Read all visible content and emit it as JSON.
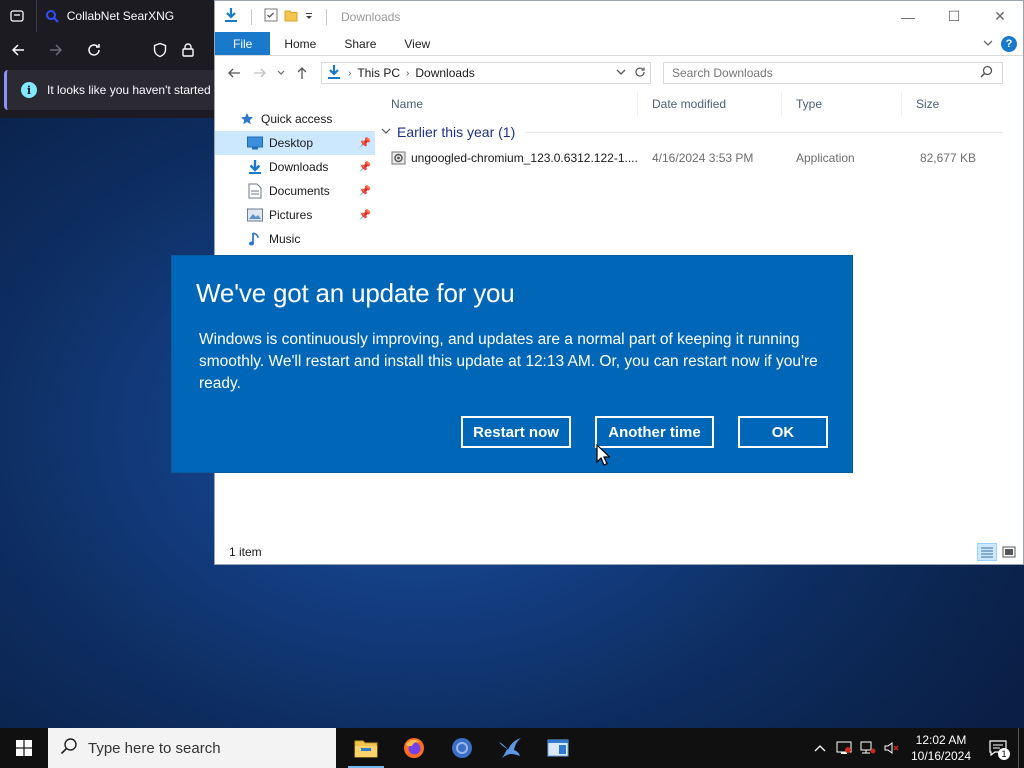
{
  "browser": {
    "tab_title": "CollabNet SearXNG",
    "infobar_text": "It looks like you haven't started"
  },
  "explorer": {
    "window_title": "Downloads",
    "ribbon_tabs": [
      "File",
      "Home",
      "Share",
      "View"
    ],
    "breadcrumb": [
      "This PC",
      "Downloads"
    ],
    "search_placeholder": "Search Downloads",
    "nav_items": [
      {
        "label": "Quick access",
        "icon": "star-icon"
      },
      {
        "label": "Desktop",
        "icon": "desktop-folder-icon",
        "pinned": true,
        "selected": true
      },
      {
        "label": "Downloads",
        "icon": "download-folder-icon",
        "pinned": true
      },
      {
        "label": "Documents",
        "icon": "documents-folder-icon",
        "pinned": true
      },
      {
        "label": "Pictures",
        "icon": "pictures-folder-icon",
        "pinned": true
      },
      {
        "label": "Music",
        "icon": "music-folder-icon"
      }
    ],
    "columns": [
      "Name",
      "Date modified",
      "Type",
      "Size"
    ],
    "group_label": "Earlier this year (1)",
    "files": [
      {
        "name": "ungoogled-chromium_123.0.6312.122-1....",
        "date": "4/16/2024 3:53 PM",
        "type": "Application",
        "size": "82,677 KB"
      }
    ],
    "status": "1 item"
  },
  "dialog": {
    "title": "We've got an update for you",
    "body": "Windows is continuously improving, and updates are a normal part of keeping it running smoothly. We'll restart and install this update at 12:13 AM. Or, you can restart now if you're ready.",
    "buttons": {
      "restart": "Restart now",
      "later": "Another time",
      "ok": "OK"
    }
  },
  "taskbar": {
    "search_placeholder": "Type here to search",
    "pinned_apps": [
      "file-explorer-icon",
      "firefox-icon",
      "chromium-icon",
      "bird-app-icon",
      "window-app-icon"
    ],
    "clock_time": "12:02 AM",
    "clock_date": "10/16/2024",
    "notification_count": "1"
  },
  "colors": {
    "dialog_blue": "#0067b8",
    "ribbon_file_blue": "#1979ca",
    "selection_blue": "#cce8ff",
    "group_header_blue": "#1e3287",
    "taskbar": "#101010"
  }
}
